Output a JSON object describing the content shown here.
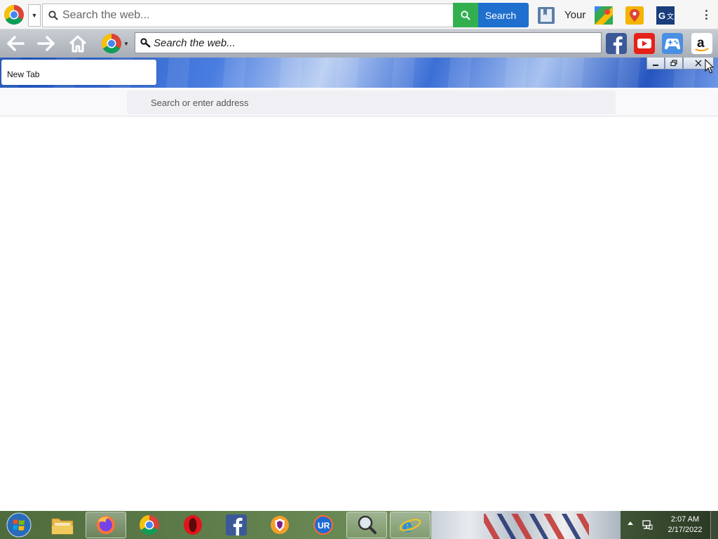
{
  "top_toolbar": {
    "search_placeholder": "Search the web...",
    "search_button": "Search",
    "your_label": "Your"
  },
  "nav_toolbar": {
    "search_placeholder": "Search the web..."
  },
  "tab": {
    "label": "New Tab"
  },
  "address_bar": {
    "placeholder": "Search or enter address"
  },
  "taskbar": {
    "time": "2:07 AM",
    "date": "2/17/2022",
    "apps": [
      "file-explorer",
      "firefox",
      "chrome",
      "opera",
      "facebook",
      "brave",
      "ur-browser",
      "magnifier",
      "internet-explorer"
    ]
  },
  "colors": {
    "search_green": "#32b04f",
    "search_blue": "#1f6fcf",
    "tab_strip_blue": "#2556c0"
  },
  "icons": {
    "top_toolbar": [
      "chrome-logo-icon",
      "dropdown-icon",
      "search-icon",
      "bookmark-icon",
      "google-maps-icon",
      "maps-pin-icon",
      "google-translate-icon",
      "more-menu-icon"
    ],
    "nav_toolbar": [
      "back-icon",
      "forward-icon",
      "home-icon",
      "chrome-icon",
      "key-search-icon",
      "facebook-icon",
      "youtube-icon",
      "games-icon",
      "amazon-icon"
    ]
  }
}
